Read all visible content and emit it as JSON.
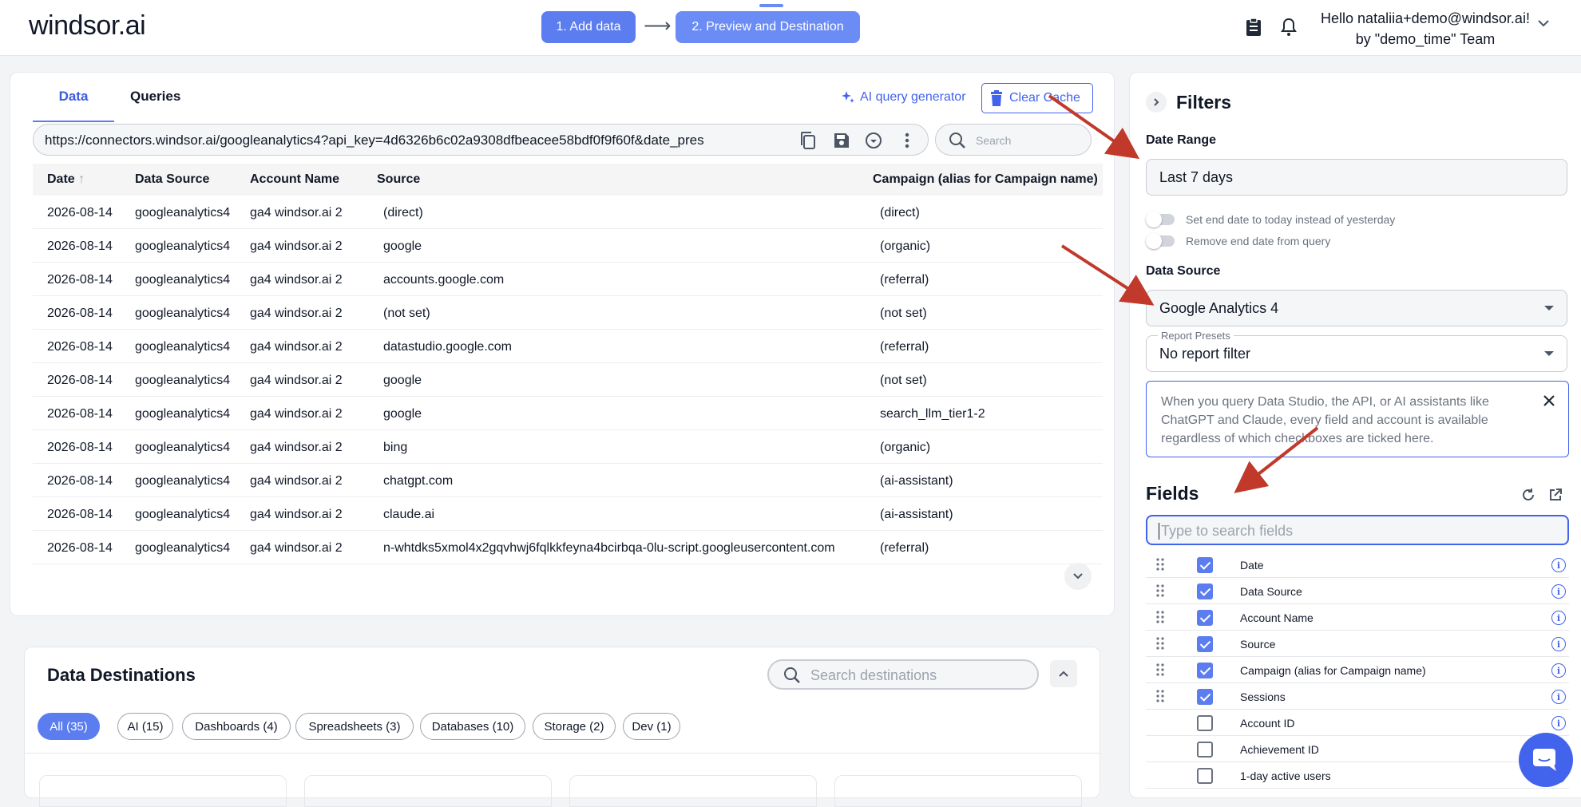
{
  "header": {
    "logo": "windsor.ai",
    "step1": "1. Add data",
    "step2": "2. Preview and Destination",
    "greeting_line1": "Hello nataliia+demo@windsor.ai!",
    "greeting_line2": "by \"demo_time\" Team"
  },
  "data_panel": {
    "tabs": [
      "Data",
      "Queries"
    ],
    "active_tab": "Data",
    "ai_query_label": "AI query generator",
    "clear_cache_label": "Clear Cache",
    "url": "https://connectors.windsor.ai/googleanalytics4?api_key=4d6326b6c02a9308dfbeacee58bdf0f9f60f&date_pres",
    "search_placeholder": "Search",
    "columns": [
      "Date",
      "Data Source",
      "Account Name",
      "Source",
      "Campaign (alias for Campaign name)"
    ],
    "rows": [
      [
        "2026-08-14",
        "googleanalytics4",
        "ga4 windsor.ai 2",
        "(direct)",
        "(direct)"
      ],
      [
        "2026-08-14",
        "googleanalytics4",
        "ga4 windsor.ai 2",
        "google",
        "(organic)"
      ],
      [
        "2026-08-14",
        "googleanalytics4",
        "ga4 windsor.ai 2",
        "accounts.google.com",
        "(referral)"
      ],
      [
        "2026-08-14",
        "googleanalytics4",
        "ga4 windsor.ai 2",
        "(not set)",
        "(not set)"
      ],
      [
        "2026-08-14",
        "googleanalytics4",
        "ga4 windsor.ai 2",
        "datastudio.google.com",
        "(referral)"
      ],
      [
        "2026-08-14",
        "googleanalytics4",
        "ga4 windsor.ai 2",
        "google",
        "(not set)"
      ],
      [
        "2026-08-14",
        "googleanalytics4",
        "ga4 windsor.ai 2",
        "google",
        "search_llm_tier1-2"
      ],
      [
        "2026-08-14",
        "googleanalytics4",
        "ga4 windsor.ai 2",
        "bing",
        "(organic)"
      ],
      [
        "2026-08-14",
        "googleanalytics4",
        "ga4 windsor.ai 2",
        "chatgpt.com",
        "(ai-assistant)"
      ],
      [
        "2026-08-14",
        "googleanalytics4",
        "ga4 windsor.ai 2",
        "claude.ai",
        "(ai-assistant)"
      ],
      [
        "2026-08-14",
        "googleanalytics4",
        "ga4 windsor.ai 2",
        "n-whtdks5xmol4x2gqvhwj6fqlkkfeyna4bcirbqa-0lu-script.googleusercontent.com",
        "(referral)"
      ]
    ]
  },
  "destinations": {
    "title": "Data Destinations",
    "search_placeholder": "Search destinations",
    "chips": [
      "All (35)",
      "AI (15)",
      "Dashboards (4)",
      "Spreadsheets (3)",
      "Databases (10)",
      "Storage (2)",
      "Dev (1)"
    ],
    "active_chip": "All (35)"
  },
  "filters": {
    "title": "Filters",
    "date_range_label": "Date Range",
    "date_range_value": "Last 7 days",
    "toggle1": "Set end date to today instead of yesterday",
    "toggle2": "Remove end date from query",
    "data_source_label": "Data Source",
    "data_source_value": "Google Analytics 4",
    "report_presets_label": "Report Presets",
    "report_presets_value": "No report filter",
    "info_text": "When you query Data Studio, the API, or AI assistants like ChatGPT and Claude, every field and account is available regardless of which checkboxes are ticked here.",
    "fields_title": "Fields",
    "field_search_placeholder": "Type to search fields",
    "fields": [
      {
        "name": "Date",
        "checked": true
      },
      {
        "name": "Data Source",
        "checked": true
      },
      {
        "name": "Account Name",
        "checked": true
      },
      {
        "name": "Source",
        "checked": true
      },
      {
        "name": "Campaign (alias for Campaign name)",
        "checked": true
      },
      {
        "name": "Sessions",
        "checked": true
      },
      {
        "name": "Account ID",
        "checked": false
      },
      {
        "name": "Achievement ID",
        "checked": false
      },
      {
        "name": "1-day active users",
        "checked": false
      }
    ]
  },
  "colors": {
    "accent": "#5b7df0",
    "link": "#4263eb",
    "annotation_arrow": "#c0392b"
  }
}
